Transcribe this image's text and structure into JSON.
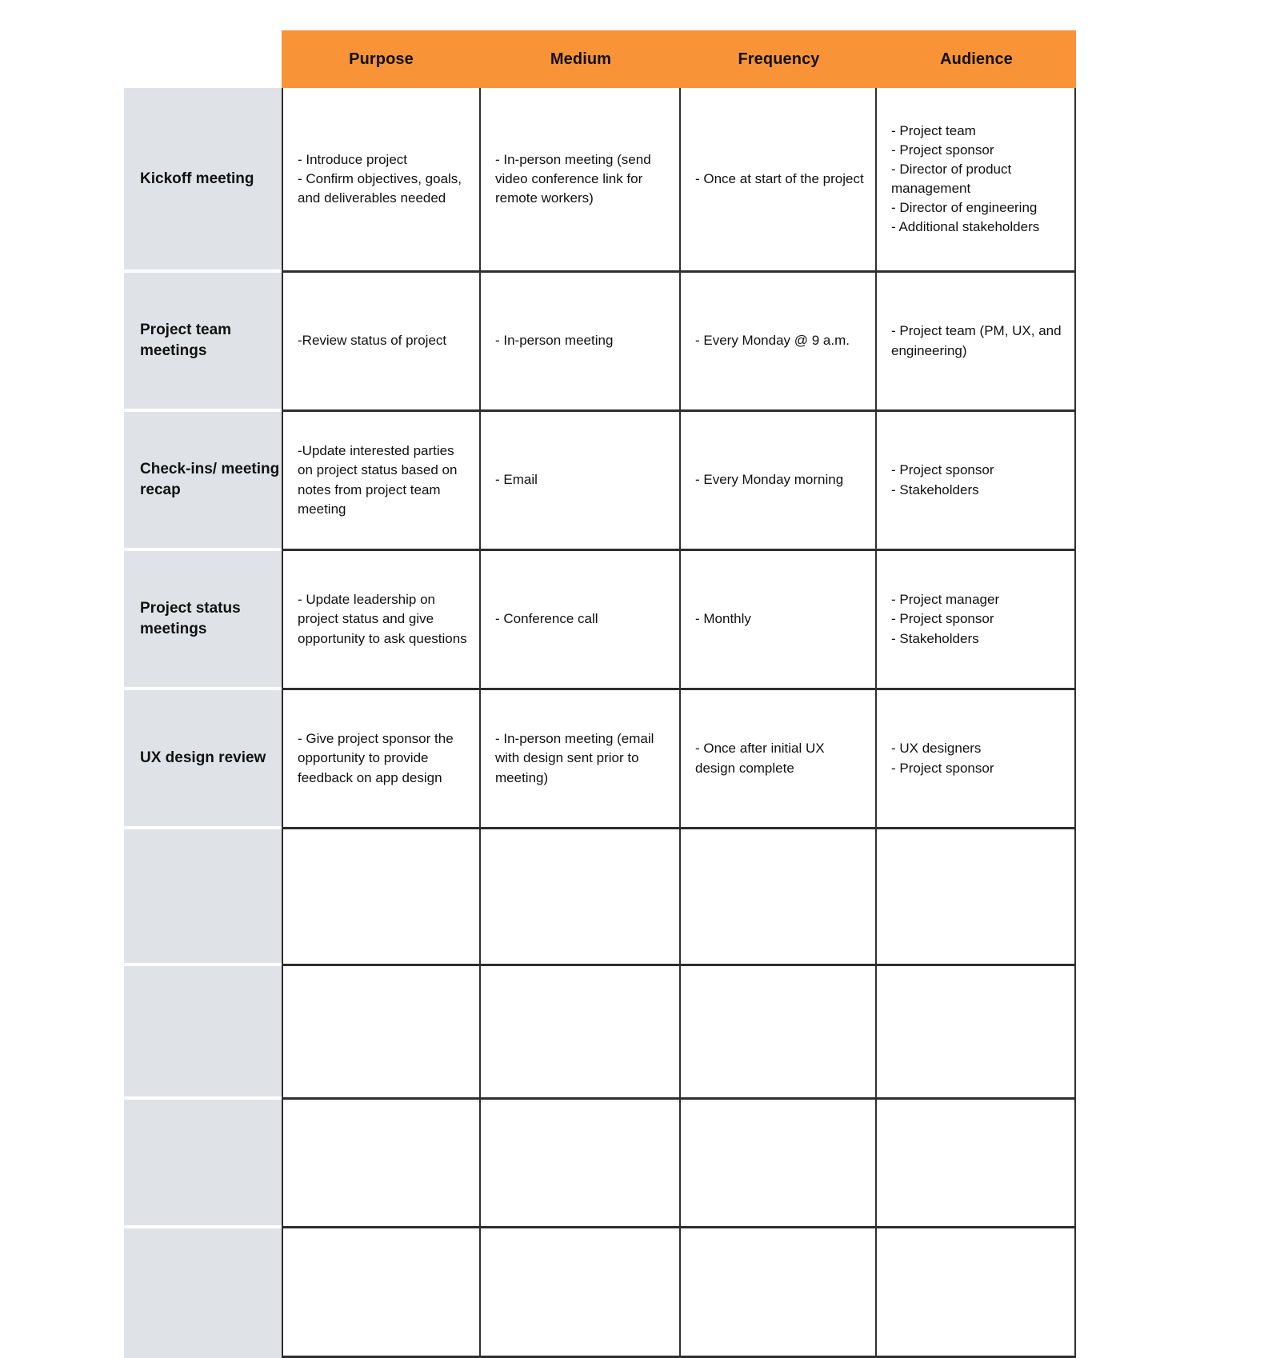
{
  "table": {
    "colors": {
      "header_background": "#F99338",
      "header_text": "#111111",
      "row_label_background": "#DFE3E8",
      "grid_line": "#2E2E2E",
      "cell_background": "#FFFFFF"
    },
    "corner_label": "",
    "columns": [
      {
        "key": "purpose",
        "label": "Purpose"
      },
      {
        "key": "medium",
        "label": "Medium"
      },
      {
        "key": "frequency",
        "label": "Frequency"
      },
      {
        "key": "audience",
        "label": "Audience"
      }
    ],
    "rows": [
      {
        "label": "Kickoff meeting",
        "purpose": "- Introduce project\n- Confirm objectives, goals, and deliverables needed",
        "medium": "- In-person meeting (send video conference link for remote workers)",
        "frequency": "- Once at start of the project",
        "audience": "- Project team\n- Project sponsor\n- Director of product management\n- Director of engineering\n- Additional stakeholders"
      },
      {
        "label": "Project team meetings",
        "purpose": "-Review status of project",
        "medium": "- In-person meeting",
        "frequency": "- Every Monday @ 9 a.m.",
        "audience": "- Project team (PM, UX, and engineering)"
      },
      {
        "label": "Check-ins/ meeting recap",
        "purpose": "-Update interested parties on project status based on notes from project team meeting",
        "medium": "- Email",
        "frequency": "- Every Monday morning",
        "audience": "- Project sponsor\n- Stakeholders"
      },
      {
        "label": "Project status meetings",
        "purpose": "- Update leadership on project status and give opportunity to ask questions",
        "medium": "- Conference call",
        "frequency": "- Monthly",
        "audience": "- Project manager\n- Project sponsor\n- Stakeholders"
      },
      {
        "label": "UX design review",
        "purpose": "- Give project sponsor the opportunity to provide feedback on app design",
        "medium": "- In-person meeting (email with design sent prior to meeting)",
        "frequency": "- Once after initial UX design complete",
        "audience": "- UX designers\n- Project sponsor"
      },
      {
        "label": "",
        "purpose": "",
        "medium": "",
        "frequency": "",
        "audience": ""
      },
      {
        "label": "",
        "purpose": "",
        "medium": "",
        "frequency": "",
        "audience": ""
      },
      {
        "label": "",
        "purpose": "",
        "medium": "",
        "frequency": "",
        "audience": ""
      },
      {
        "label": "",
        "purpose": "",
        "medium": "",
        "frequency": "",
        "audience": ""
      }
    ]
  }
}
